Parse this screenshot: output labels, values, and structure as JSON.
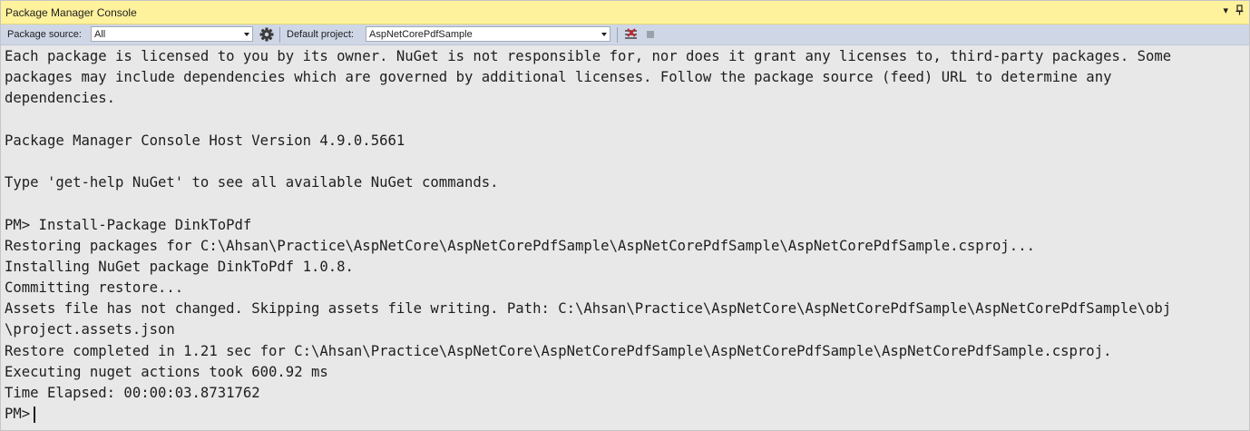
{
  "window": {
    "title": "Package Manager Console",
    "dropdown_glyph": "▾",
    "pin_glyph": "🖈"
  },
  "toolbar": {
    "package_source_label": "Package source:",
    "package_source_value": "All",
    "default_project_label": "Default project:",
    "default_project_value": "AspNetCorePdfSample",
    "icons": [
      "settings-gear-icon",
      "clear-console-icon",
      "stop-command-icon"
    ]
  },
  "console": {
    "lines": [
      "Each package is licensed to you by its owner. NuGet is not responsible for, nor does it grant any licenses to, third-party packages. Some",
      "packages may include dependencies which are governed by additional licenses. Follow the package source (feed) URL to determine any",
      "dependencies.",
      "",
      "Package Manager Console Host Version 4.9.0.5661",
      "",
      "Type 'get-help NuGet' to see all available NuGet commands.",
      "",
      "PM> Install-Package DinkToPdf",
      "Restoring packages for C:\\Ahsan\\Practice\\AspNetCore\\AspNetCorePdfSample\\AspNetCorePdfSample\\AspNetCorePdfSample.csproj...",
      "Installing NuGet package DinkToPdf 1.0.8.",
      "Committing restore...",
      "Assets file has not changed. Skipping assets file writing. Path: C:\\Ahsan\\Practice\\AspNetCore\\AspNetCorePdfSample\\AspNetCorePdfSample\\obj",
      "\\project.assets.json",
      "Restore completed in 1.21 sec for C:\\Ahsan\\Practice\\AspNetCore\\AspNetCorePdfSample\\AspNetCorePdfSample\\AspNetCorePdfSample.csproj.",
      "Executing nuget actions took 600.92 ms",
      "Time Elapsed: 00:00:03.8731762"
    ],
    "prompt": "PM>"
  },
  "colors": {
    "title_bar": "#fff29d",
    "toolbar": "#cfd6e5",
    "console_bg": "#e8e8e9",
    "text": "#1e1e1e",
    "clear_icon_accent": "#c0282d"
  }
}
